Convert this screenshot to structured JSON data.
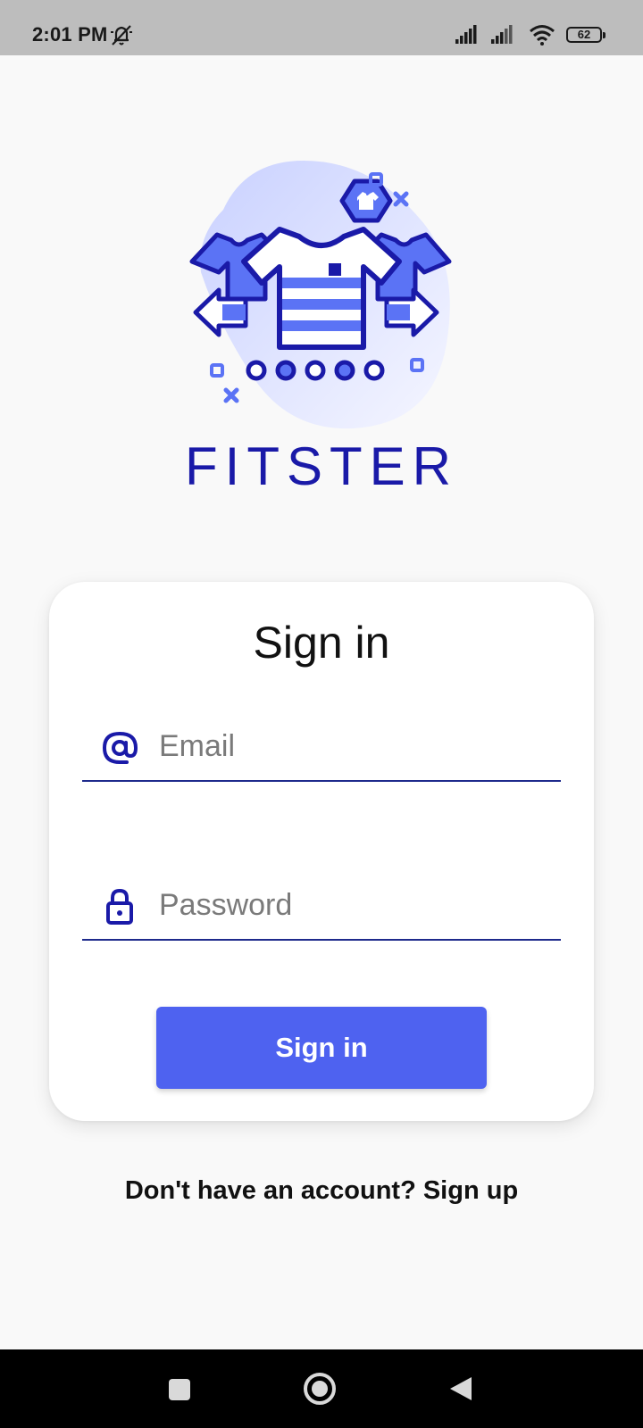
{
  "status_bar": {
    "time": "2:01 PM",
    "battery_level": "62",
    "icons": [
      "alarm-off-icon",
      "signal-icon",
      "signal-icon-2",
      "wifi-icon",
      "battery-icon"
    ]
  },
  "logo": {
    "brand_name": "FITSTER",
    "icon": "clothing-exchange-icon"
  },
  "signin_card": {
    "title": "Sign in",
    "email": {
      "placeholder": "Email",
      "value": "",
      "icon": "at-icon"
    },
    "password": {
      "placeholder": "Password",
      "value": "",
      "icon": "lock-icon"
    },
    "button_label": "Sign in"
  },
  "signup_prompt": "Don't have an account? Sign up",
  "nav_bar": {
    "buttons": [
      "recents-icon",
      "home-icon",
      "back-icon"
    ]
  },
  "colors": {
    "accent": "#4e62f0",
    "brand": "#1a1aa8",
    "underline": "#1e2a8c",
    "status_bar": "#bdbdbd",
    "background": "#f9f9f9"
  }
}
